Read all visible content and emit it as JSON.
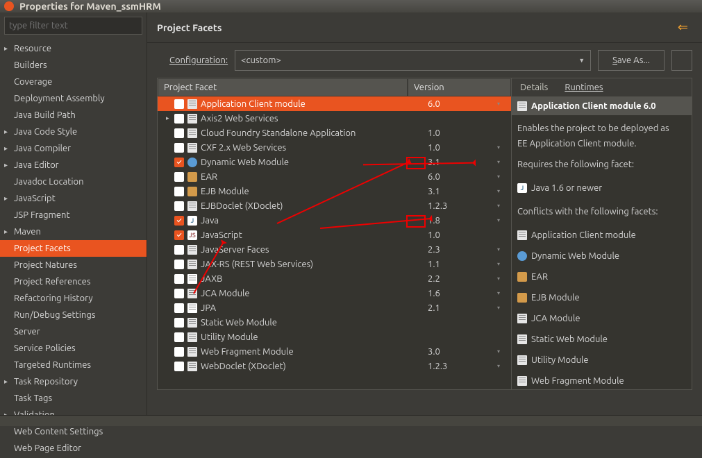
{
  "window": {
    "title": "Properties for Maven_ssmHRM"
  },
  "filter": {
    "placeholder": "type filter text"
  },
  "sidebar": {
    "items": [
      {
        "label": "Resource",
        "expandable": true
      },
      {
        "label": "Builders"
      },
      {
        "label": "Coverage"
      },
      {
        "label": "Deployment Assembly"
      },
      {
        "label": "Java Build Path"
      },
      {
        "label": "Java Code Style",
        "expandable": true
      },
      {
        "label": "Java Compiler",
        "expandable": true
      },
      {
        "label": "Java Editor",
        "expandable": true
      },
      {
        "label": "Javadoc Location"
      },
      {
        "label": "JavaScript",
        "expandable": true
      },
      {
        "label": "JSP Fragment"
      },
      {
        "label": "Maven",
        "expandable": true
      },
      {
        "label": "Project Facets",
        "selected": true
      },
      {
        "label": "Project Natures"
      },
      {
        "label": "Project References"
      },
      {
        "label": "Refactoring History"
      },
      {
        "label": "Run/Debug Settings"
      },
      {
        "label": "Server"
      },
      {
        "label": "Service Policies"
      },
      {
        "label": "Targeted Runtimes"
      },
      {
        "label": "Task Repository",
        "expandable": true
      },
      {
        "label": "Task Tags"
      },
      {
        "label": "Validation",
        "expandable": true
      },
      {
        "label": "Web Content Settings"
      },
      {
        "label": "Web Page Editor"
      }
    ]
  },
  "header": {
    "title": "Project Facets"
  },
  "config": {
    "label": "Configuration:",
    "value": "<custom>",
    "save_as": "Save As...",
    "save_as_ul": "S"
  },
  "table": {
    "headers": {
      "facet": "Project Facet",
      "version": "Version"
    },
    "rows": [
      {
        "checked": false,
        "icon": "doc",
        "name": "Application Client module",
        "version": "6.0",
        "selected": true,
        "dd": true
      },
      {
        "checked": false,
        "icon": "doc",
        "name": "Axis2 Web Services",
        "version": "",
        "expandable": true
      },
      {
        "checked": false,
        "icon": "doc",
        "name": "Cloud Foundry Standalone Application",
        "version": "1.0"
      },
      {
        "checked": false,
        "icon": "doc",
        "name": "CXF 2.x Web Services",
        "version": "1.0",
        "dd": true
      },
      {
        "checked": true,
        "icon": "globe",
        "name": "Dynamic Web Module",
        "version": "3.1",
        "dd": true
      },
      {
        "checked": false,
        "icon": "ear",
        "name": "EAR",
        "version": "6.0",
        "dd": true
      },
      {
        "checked": false,
        "icon": "ejb",
        "name": "EJB Module",
        "version": "3.1",
        "dd": true
      },
      {
        "checked": false,
        "icon": "doc",
        "name": "EJBDoclet (XDoclet)",
        "version": "1.2.3",
        "dd": true
      },
      {
        "checked": true,
        "icon": "java",
        "name": "Java",
        "version": "1.8",
        "dd": true
      },
      {
        "checked": true,
        "icon": "js",
        "name": "JavaScript",
        "version": "1.0"
      },
      {
        "checked": false,
        "icon": "doc",
        "name": "JavaServer Faces",
        "version": "2.3",
        "dd": true
      },
      {
        "checked": false,
        "icon": "doc",
        "name": "JAX-RS (REST Web Services)",
        "version": "1.1",
        "dd": true
      },
      {
        "checked": false,
        "icon": "jaxb",
        "name": "JAXB",
        "version": "2.2",
        "dd": true
      },
      {
        "checked": false,
        "icon": "doc",
        "name": "JCA Module",
        "version": "1.6",
        "dd": true
      },
      {
        "checked": false,
        "icon": "jpa",
        "name": "JPA",
        "version": "2.1",
        "dd": true
      },
      {
        "checked": false,
        "icon": "doc",
        "name": "Static Web Module",
        "version": ""
      },
      {
        "checked": false,
        "icon": "doc",
        "name": "Utility Module",
        "version": ""
      },
      {
        "checked": false,
        "icon": "doc",
        "name": "Web Fragment Module",
        "version": "3.0",
        "dd": true
      },
      {
        "checked": false,
        "icon": "doc",
        "name": "WebDoclet (XDoclet)",
        "version": "1.2.3",
        "dd": true
      }
    ]
  },
  "tabs": {
    "details": "Details",
    "runtimes": "Runtimes"
  },
  "details": {
    "title": "Application Client module 6.0",
    "desc1": "Enables the project to be deployed as",
    "desc2": "EE Application Client module.",
    "requires_label": "Requires the following facet:",
    "requires": [
      {
        "label": "Java 1.6 or newer",
        "icon": "java"
      }
    ],
    "conflicts_label": "Conflicts with the following facets:",
    "conflicts": [
      {
        "label": "Application Client module",
        "icon": "doc"
      },
      {
        "label": "Dynamic Web Module",
        "icon": "globe"
      },
      {
        "label": "EAR",
        "icon": "ear"
      },
      {
        "label": "EJB Module",
        "icon": "ejb"
      },
      {
        "label": "JCA Module",
        "icon": "doc"
      },
      {
        "label": "Static Web Module",
        "icon": "doc"
      },
      {
        "label": "Utility Module",
        "icon": "doc"
      },
      {
        "label": "Web Fragment Module",
        "icon": "doc"
      }
    ]
  }
}
